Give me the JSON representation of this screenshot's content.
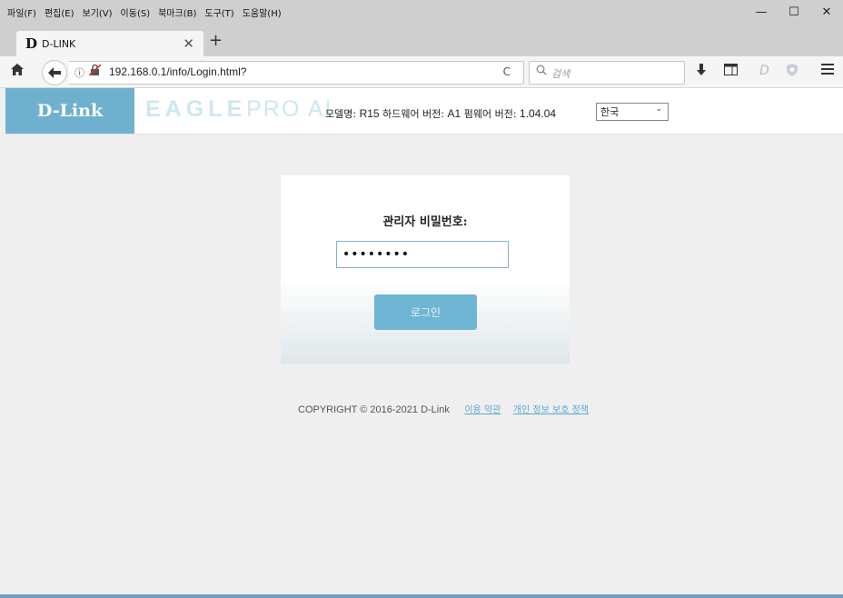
{
  "browser": {
    "menu": [
      "파일(F)",
      "편집(E)",
      "보기(V)",
      "이동(S)",
      "북마크(B)",
      "도구(T)",
      "도움말(H)"
    ],
    "window_controls": {
      "minimize": "—",
      "maximize": "☐",
      "close": "✕"
    },
    "tab": {
      "favicon": "D",
      "title": "D-LINK",
      "close": "✕"
    },
    "new_tab": "+",
    "url": "192.168.0.1/info/Login.html?",
    "search_placeholder": "검색",
    "icons": [
      "home-icon",
      "back-icon",
      "info-icon",
      "insecure-lock-icon",
      "reload-icon",
      "search-icon",
      "download-icon",
      "library-icon",
      "pocket-icon",
      "shield-icon",
      "hamburger-menu-icon"
    ]
  },
  "router": {
    "logo": "D-Link",
    "brand_eagle": "EAGLE",
    "brand_pro": "PRO AI",
    "model_label": "모델명:",
    "model_value": "R15",
    "hw_label": "하드웨어 버전:",
    "hw_value": "A1",
    "fw_label": "펌웨어 버전:",
    "fw_value": "1.04.04",
    "language": "한국",
    "language_options": [
      "한국"
    ],
    "brand_color": "#6fb0cf"
  },
  "login": {
    "label": "관리자 비밀번호:",
    "password_masked": "••••••••",
    "button": "로그인"
  },
  "footer": {
    "copyright": "COPYRIGHT © 2016-2021 D-Link",
    "terms": "이용 약관",
    "privacy": "개인 정보 보호 정책"
  }
}
